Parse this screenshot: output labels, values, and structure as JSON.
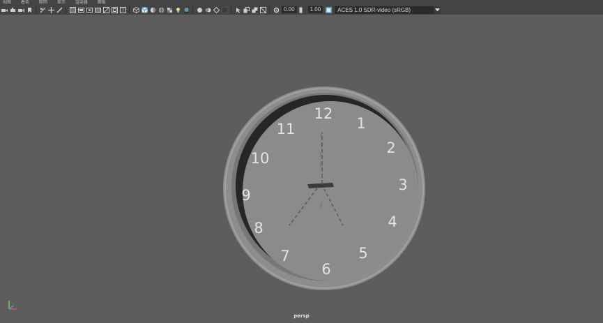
{
  "menu": {
    "items": [
      "视图",
      "着色",
      "照明",
      "显示",
      "渲染器",
      "面板"
    ]
  },
  "toolbar": {
    "exposure_value": "0.00",
    "gamma_value": "1.00",
    "color_space": "ACES 1.0 SDR-video (sRGB)",
    "accent_color": "#5285a6"
  },
  "viewport": {
    "camera_label": "persp",
    "clock_numerals": [
      "12",
      "1",
      "2",
      "3",
      "4",
      "5",
      "6",
      "7",
      "8",
      "9",
      "10",
      "11"
    ]
  }
}
